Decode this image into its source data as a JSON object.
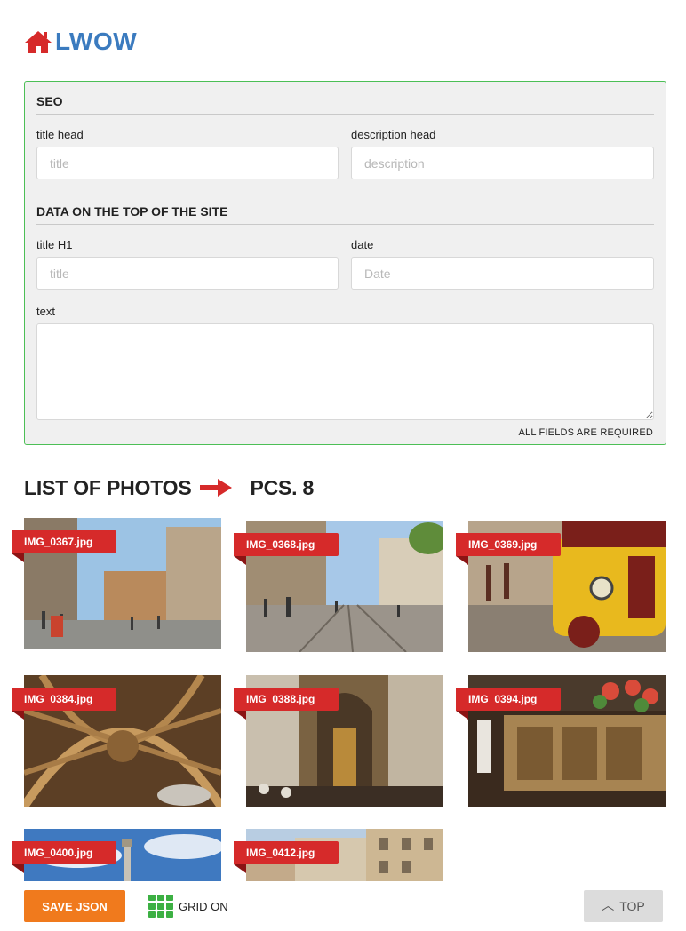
{
  "brand": {
    "name": "LWOW",
    "icon": "home-icon",
    "color": "#3b7bbf",
    "icon_color": "#d62a2a"
  },
  "seo": {
    "section_title": "SEO",
    "title_head_label": "title head",
    "title_head_placeholder": "title",
    "title_head_value": "",
    "description_head_label": "description head",
    "description_head_placeholder": "description",
    "description_head_value": ""
  },
  "top_data": {
    "section_title": "DATA ON THE TOP OF THE SITE",
    "title_h1_label": "title H1",
    "title_h1_placeholder": "title",
    "title_h1_value": "",
    "date_label": "date",
    "date_placeholder": "Date",
    "date_value": "",
    "text_label": "text",
    "text_value": ""
  },
  "required_note": "ALL FIELDS ARE REQUIRED",
  "list": {
    "title": "LIST OF PHOTOS",
    "count_label": "PCS. 8",
    "arrow_icon": "arrow-right-icon"
  },
  "photos": [
    {
      "filename": "IMG_0367.jpg",
      "scene": "city-street"
    },
    {
      "filename": "IMG_0368.jpg",
      "scene": "square-with-tram"
    },
    {
      "filename": "IMG_0369.jpg",
      "scene": "yellow-tour-train"
    },
    {
      "filename": "IMG_0384.jpg",
      "scene": "vaulted-ceiling"
    },
    {
      "filename": "IMG_0388.jpg",
      "scene": "cathedral-interior"
    },
    {
      "filename": "IMG_0394.jpg",
      "scene": "carved-altar"
    },
    {
      "filename": "IMG_0400.jpg",
      "scene": "column-and-sky"
    },
    {
      "filename": "IMG_0412.jpg",
      "scene": "building-facades"
    }
  ],
  "footer": {
    "save_label": "SAVE JSON",
    "grid_label": "GRID ON",
    "grid_icon": "grid-icon",
    "top_label": "TOP",
    "top_icon": "chevron-up-icon"
  },
  "colors": {
    "panel_border": "#4cbf56",
    "tag_red": "#d62a2a",
    "save_orange": "#f07a1d",
    "grid_green": "#3cb043"
  }
}
